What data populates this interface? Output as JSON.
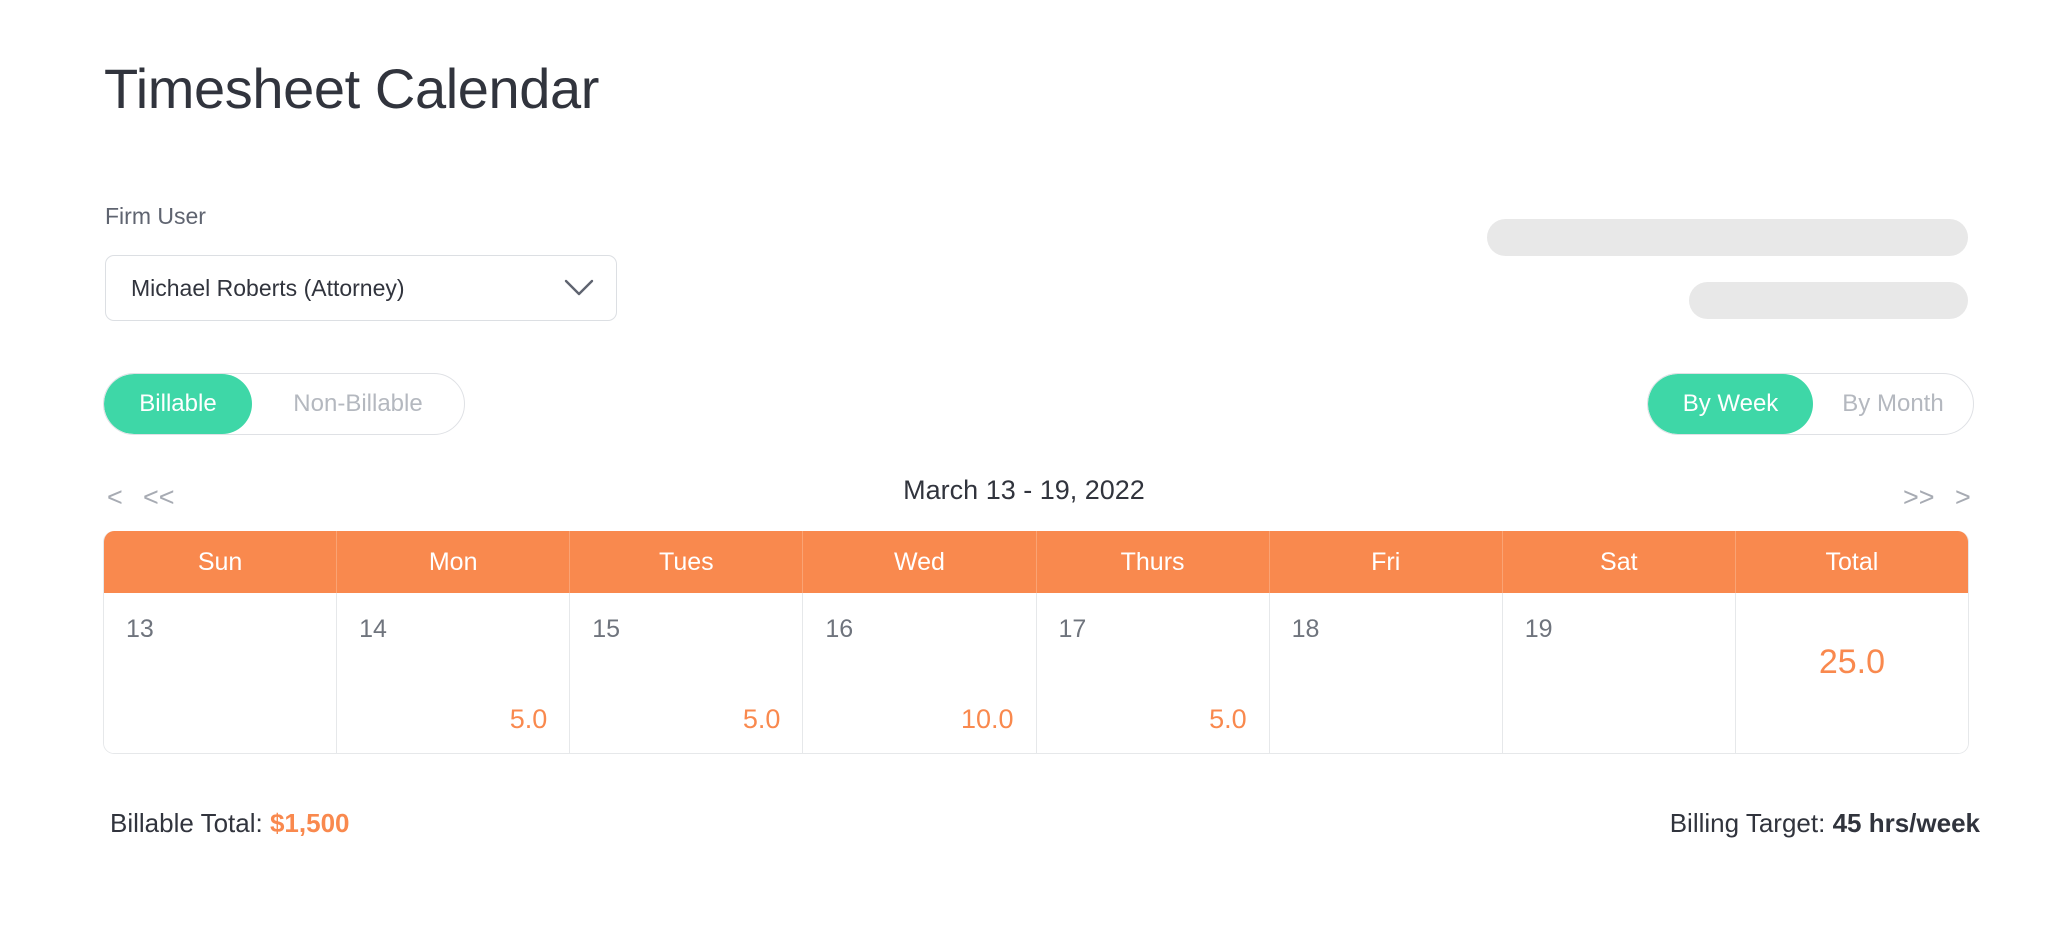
{
  "page": {
    "title": "Timesheet Calendar"
  },
  "firm_user": {
    "label": "Firm User",
    "selected": "Michael Roberts (Attorney)",
    "chevron_icon": "chevron-down-icon"
  },
  "placeholders": {
    "bar_1": "",
    "bar_2": ""
  },
  "billable_toggle": {
    "options": [
      "Billable",
      "Non-Billable"
    ],
    "active_index": 0
  },
  "period_toggle": {
    "options": [
      "By Week",
      "By Month"
    ],
    "active_index": 0
  },
  "navigation": {
    "prev": "<",
    "prev_fast": "<<",
    "next_fast": ">>",
    "next": ">",
    "range_label": "March 13 - 19, 2022"
  },
  "calendar": {
    "columns": [
      "Sun",
      "Mon",
      "Tues",
      "Wed",
      "Thurs",
      "Fri",
      "Sat",
      "Total"
    ],
    "days": [
      {
        "date": "13",
        "hours": ""
      },
      {
        "date": "14",
        "hours": "5.0"
      },
      {
        "date": "15",
        "hours": "5.0"
      },
      {
        "date": "16",
        "hours": "10.0"
      },
      {
        "date": "17",
        "hours": "5.0"
      },
      {
        "date": "18",
        "hours": ""
      },
      {
        "date": "19",
        "hours": ""
      }
    ],
    "total": "25.0"
  },
  "footer": {
    "billable_total_label": "Billable Total:",
    "billable_total_value": "$1,500",
    "billing_target_label": "Billing Target:",
    "billing_target_value": "45 hrs/week"
  },
  "colors": {
    "accent_orange": "#f9894e",
    "accent_teal": "#3ed7a7",
    "text_dark": "#31343d",
    "text_muted": "#6f747d",
    "border": "#e6e8ea",
    "skeleton": "#e8e8e8"
  }
}
